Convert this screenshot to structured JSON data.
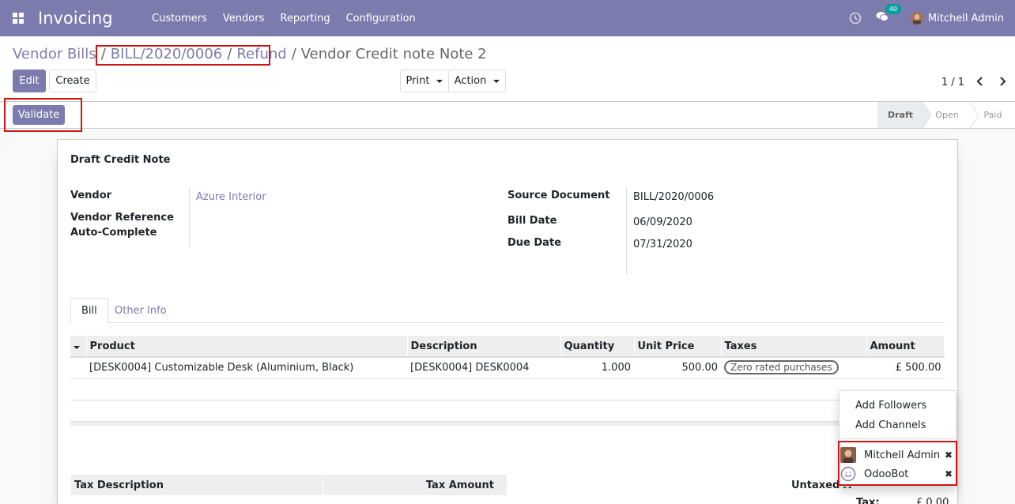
{
  "navbar": {
    "app_title": "Invoicing",
    "menu": [
      "Customers",
      "Vendors",
      "Reporting",
      "Configuration"
    ],
    "chat_badge": "40",
    "user_name": "Mitchell Admin"
  },
  "breadcrumb": {
    "items": [
      "Vendor Bills",
      "BILL/2020/0006",
      "Refund"
    ],
    "current": "Vendor Credit note Note 2",
    "separator": "/"
  },
  "buttons": {
    "edit": "Edit",
    "create": "Create",
    "print": "Print",
    "action": "Action",
    "validate": "Validate"
  },
  "pager": {
    "value": "1 / 1"
  },
  "stages": [
    "Draft",
    "Open",
    "Paid"
  ],
  "sheet": {
    "title": "Draft Credit Note",
    "vendor_label": "Vendor",
    "vendor_value": "Azure Interior",
    "vendor_ref_label": "Vendor Reference",
    "auto_complete_label": "Auto-Complete",
    "source_doc_label": "Source Document",
    "source_doc_value": "BILL/2020/0006",
    "bill_date_label": "Bill Date",
    "bill_date_value": "06/09/2020",
    "due_date_label": "Due Date",
    "due_date_value": "07/31/2020"
  },
  "tabs": [
    "Bill",
    "Other Info"
  ],
  "lines": {
    "headers": [
      "Product",
      "Description",
      "Quantity",
      "Unit Price",
      "Taxes",
      "Amount"
    ],
    "rows": [
      {
        "product": "[DESK0004] Customizable Desk (Aluminium, Black)",
        "description": "[DESK0004] DESK0004",
        "quantity": "1.000",
        "unit_price": "500.00",
        "taxes": "Zero rated purchases",
        "amount": "£ 500.00"
      }
    ]
  },
  "tax_table": {
    "headers": [
      "Tax Description",
      "Tax Amount"
    ]
  },
  "totals": {
    "untaxed_label": "Untaxed A",
    "tax_label": "Tax:",
    "tax_value": "£ 0.00"
  },
  "dropdown": {
    "items": [
      "Add Followers",
      "Add Channels"
    ],
    "followers": [
      "Mitchell Admin",
      "OdooBot"
    ]
  },
  "colors": {
    "brand": "#7c7bad",
    "highlight": "#d01414"
  }
}
